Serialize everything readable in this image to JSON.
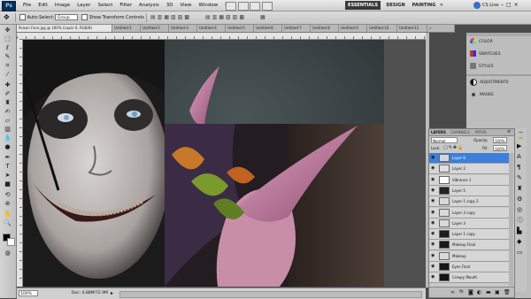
{
  "menu": {
    "logo": "Ps",
    "items": [
      "File",
      "Edit",
      "Image",
      "Layer",
      "Select",
      "Filter",
      "Analysis",
      "3D",
      "View",
      "Window",
      "Help"
    ],
    "workspaces": [
      "ESSENTIALS",
      "DESIGN",
      "PAINTING"
    ],
    "cs_live": "CS Live"
  },
  "options": {
    "auto_select_label": "Auto-Select:",
    "auto_select_value": "Group",
    "show_transform_label": "Show Transform Controls"
  },
  "document_tabs": [
    "Poison Face.jpg @ 100% (Layer 6, RGB/8)",
    "Untitled-1",
    "Untitled-2",
    "Untitled-3",
    "Untitled-4",
    "Untitled-5",
    "Untitled-6",
    "Untitled-7",
    "Untitled-8",
    "Untitled-9",
    "Untitled-10",
    "Untitled-11"
  ],
  "status": {
    "zoom": "100%",
    "doc": "Doc: 4.88M/72.9M"
  },
  "dock": {
    "items": [
      "COLOR",
      "SWATCHES",
      "STYLES",
      "ADJUSTMENTS",
      "MASKS"
    ]
  },
  "layers_panel": {
    "tabs": [
      "LAYERS",
      "CHANNELS",
      "PATHS"
    ],
    "blend_mode": "Normal",
    "opacity_label": "Opacity:",
    "opacity_value": "100%",
    "lock_label": "Lock:",
    "fill_label": "Fill:",
    "fill_value": "100%",
    "layers": [
      {
        "name": "Layer 6",
        "selected": true,
        "thumb": "#cfd8e0"
      },
      {
        "name": "Layer 2",
        "selected": false,
        "thumb": "#e0e0e0"
      },
      {
        "name": "Vibrance 1",
        "selected": false,
        "thumb": "#ffffff"
      },
      {
        "name": "Layer 5",
        "selected": false,
        "thumb": "#222222"
      },
      {
        "name": "Layer 1 copy 2",
        "selected": false,
        "thumb": "#d9d9d9"
      },
      {
        "name": "Layer 3 copy",
        "selected": false,
        "thumb": "#d9d9d9"
      },
      {
        "name": "Layer 3",
        "selected": false,
        "thumb": "#d9d9d9"
      },
      {
        "name": "Layer 1 copy",
        "selected": false,
        "thumb": "#1d1d1d"
      },
      {
        "name": "Makeup Final",
        "selected": false,
        "thumb": "#1a1a1a"
      },
      {
        "name": "Makeup",
        "selected": false,
        "thumb": "#d9d9d9"
      },
      {
        "name": "Eyes Final",
        "selected": false,
        "thumb": "#151515"
      },
      {
        "name": "Creepy Mouth",
        "selected": false,
        "thumb": "#151515"
      }
    ],
    "footer_icons": [
      "link-icon",
      "fx-icon",
      "mask-icon",
      "adjustment-icon",
      "folder-icon",
      "new-layer-icon",
      "trash-icon"
    ]
  },
  "colors": {
    "selected_layer": "#3d7fdb",
    "essentials_bg": "#3a3a3a",
    "menu_bg": "#d9d9d9"
  }
}
